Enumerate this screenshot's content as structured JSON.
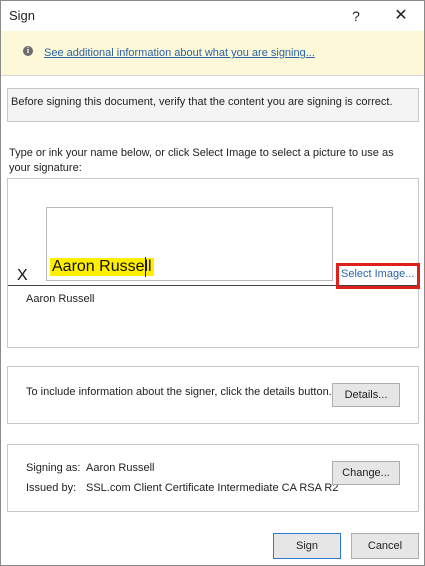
{
  "window": {
    "title": "Sign",
    "help_glyph": "?",
    "close_glyph": "✕"
  },
  "infobar": {
    "icon": "info-icon",
    "icon_glyph": "i",
    "link_text": "See additional information about what you are signing..."
  },
  "verify": {
    "text": "Before signing this document, verify that the content you are signing is correct."
  },
  "instructions": {
    "text": "Type or ink your name below, or click Select Image to select a picture to use as your signature:"
  },
  "signature": {
    "typed_name": "Aaron Russell",
    "x_mark": "X",
    "select_image_label": "Select Image...",
    "signer_name": "Aaron Russell"
  },
  "details": {
    "text": "To include information about the signer, click the details button.",
    "button_label": "Details..."
  },
  "signing_info": {
    "signing_as_label": "Signing as:",
    "signing_as_value": "Aaron Russell",
    "issued_by_label": "Issued by:",
    "issued_by_value": "SSL.com Client Certificate Intermediate CA RSA R2",
    "change_button_label": "Change..."
  },
  "actions": {
    "sign_label": "Sign",
    "cancel_label": "Cancel"
  },
  "colors": {
    "highlight": "#ffee00",
    "link": "#2a63a8",
    "callout": "#e0201a",
    "infobar_bg": "#fdf8d7"
  }
}
